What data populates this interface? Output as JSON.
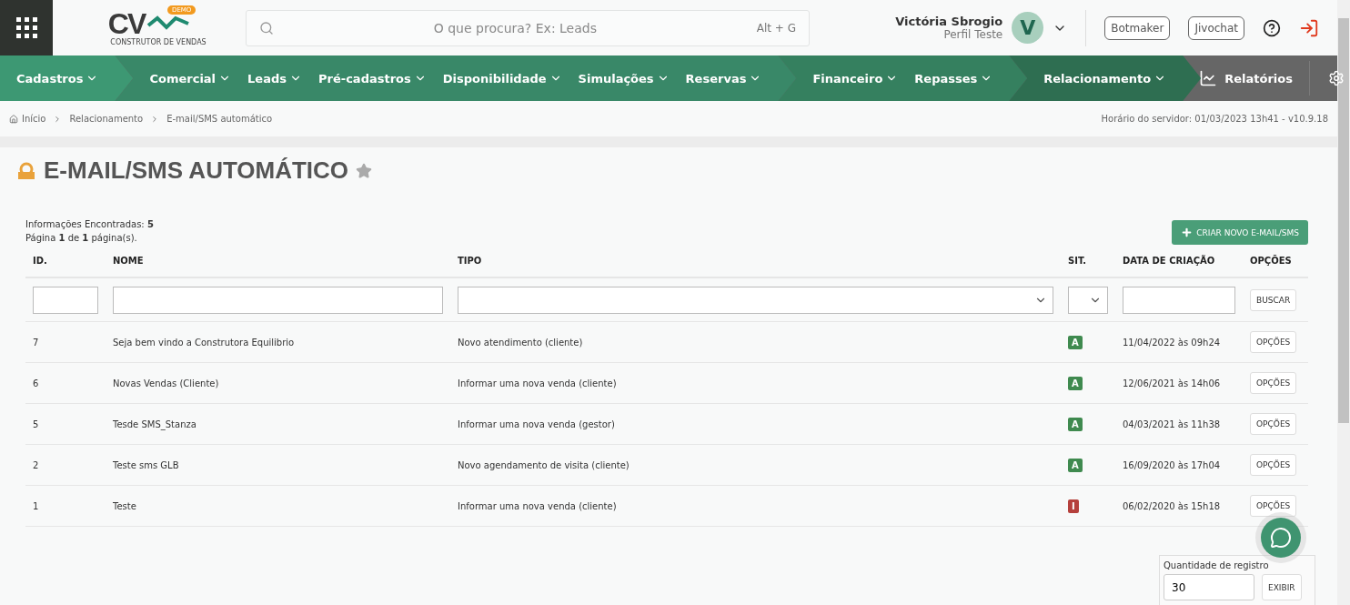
{
  "header": {
    "logo_badge": "DEMO",
    "logo_text": "CV",
    "logo_caption": "CONSTRUTOR DE VENDAS",
    "search": {
      "placeholder": "O que procura? Ex: Leads",
      "shortcut": "Alt + G"
    },
    "user": {
      "name": "Victória Sbrogio",
      "profile": "Perfil Teste",
      "initial": "V"
    },
    "buttons": [
      "Botmaker",
      "Jivochat"
    ]
  },
  "nav": {
    "groups": [
      {
        "color": "#3d9873",
        "items": [
          "Cadastros"
        ]
      },
      {
        "color": "#398868",
        "items": [
          "Comercial",
          "Leads",
          "Pré-cadastros",
          "Disponibilidade",
          "Simulações",
          "Reservas"
        ]
      },
      {
        "color": "#35805f",
        "items": [
          "Financeiro",
          "Repasses"
        ]
      },
      {
        "color": "#2e6e51",
        "items": [
          "Relacionamento"
        ]
      }
    ],
    "reports": "Relatórios"
  },
  "breadcrumb": [
    "Início",
    "Relacionamento",
    "E-mail/SMS automático"
  ],
  "server_time": "Horário do servidor: 01/03/2023 13h41 - v10.9.18",
  "page": {
    "title": "E-MAIL/SMS AUTOMÁTICO",
    "favorite": false
  },
  "summary": {
    "found": "Informações Encontradas: **5**",
    "pages": "Página **1** de **1** página(s)."
  },
  "create_button": "CRIAR NOVO E-MAIL/SMS",
  "table": {
    "columns": [
      "ID.",
      "NOME",
      "TIPO",
      "SIT.",
      "DATA DE CRIAÇÃO",
      "OPÇÕES"
    ],
    "search_button": "BUSCAR",
    "rows": [
      {
        "id": "7",
        "name": "Seja bem vindo a Construtora Equilibrio",
        "type": "Novo atendimento (cliente)",
        "status": "A",
        "color": "#3f8a4f",
        "created": "11/04/2022 às 09h24",
        "action": "OPÇÕES"
      },
      {
        "id": "6",
        "name": "Novas Vendas (Cliente)",
        "type": "Informar uma nova venda (cliente)",
        "status": "A",
        "color": "#3f8a4f",
        "created": "12/06/2021 às 14h06",
        "action": "OPÇÕES"
      },
      {
        "id": "5",
        "name": "Tesde SMS_Stanza",
        "type": "Informar uma nova venda (gestor)",
        "status": "A",
        "color": "#3f8a4f",
        "created": "04/03/2021 às 11h38",
        "action": "OPÇÕES"
      },
      {
        "id": "2",
        "name": "Teste sms GLB",
        "type": "Novo agendamento de visita (cliente)",
        "status": "A",
        "color": "#3f8a4f",
        "created": "16/09/2020 às 17h04",
        "action": "OPÇÕES"
      },
      {
        "id": "1",
        "name": "Teste",
        "type": "Informar uma nova venda (cliente)",
        "status": "I",
        "color": "#b5403c",
        "created": "06/02/2020 às 15h18",
        "action": "OPÇÕES"
      }
    ]
  },
  "records": {
    "label": "Quantidade de registro",
    "value": "30",
    "button": "EXIBIR"
  }
}
